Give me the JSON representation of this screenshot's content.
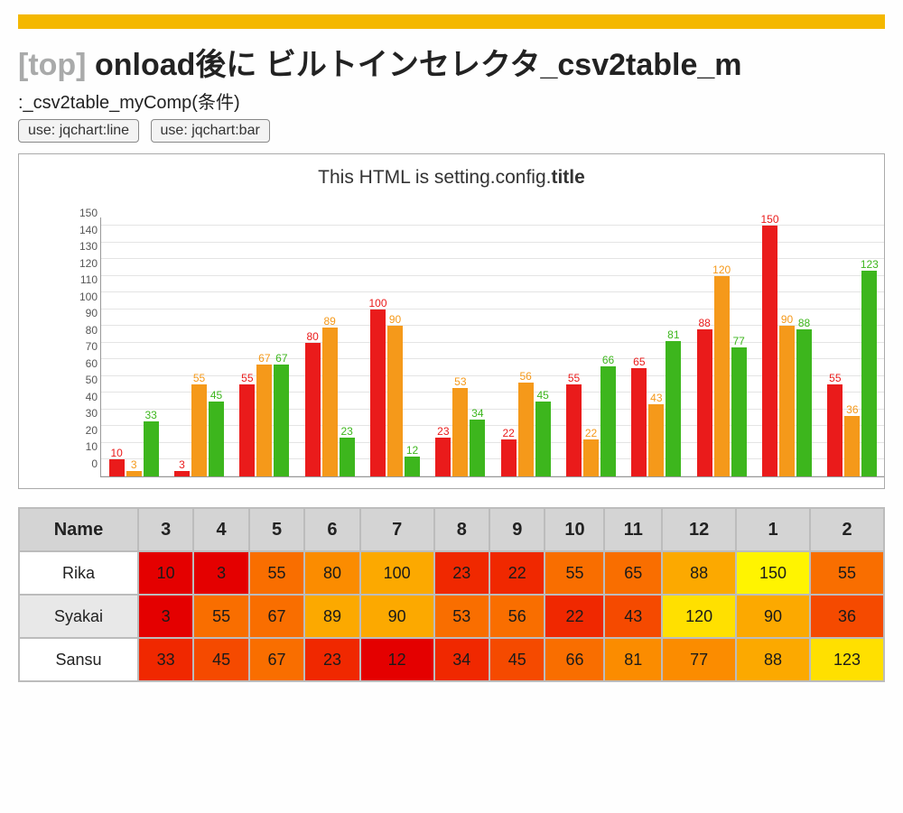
{
  "top_link_text": "[top]",
  "page_title_rest": " onload後に ビルトインセレクタ_csv2table_m",
  "subtitle": ":_csv2table_myComp(条件)",
  "buttons": {
    "line": "use: jqchart:line",
    "bar": "use: jqchart:bar"
  },
  "chart_title_prefix": "This HTML is setting.config.",
  "chart_title_bold": "title",
  "y_ticks": [
    0,
    10,
    20,
    30,
    40,
    50,
    60,
    70,
    80,
    90,
    100,
    110,
    120,
    130,
    140,
    150
  ],
  "y_max": 155,
  "table": {
    "headers": [
      "Name",
      "3",
      "4",
      "5",
      "6",
      "7",
      "8",
      "9",
      "10",
      "11",
      "12",
      "1",
      "2"
    ],
    "rows": [
      {
        "name": "Rika",
        "values": [
          10,
          3,
          55,
          80,
          100,
          23,
          22,
          55,
          65,
          88,
          150,
          55
        ]
      },
      {
        "name": "Syakai",
        "values": [
          3,
          55,
          67,
          89,
          90,
          53,
          56,
          22,
          43,
          120,
          90,
          36
        ]
      },
      {
        "name": "Sansu",
        "values": [
          33,
          45,
          67,
          23,
          12,
          34,
          45,
          66,
          81,
          77,
          88,
          123
        ]
      }
    ]
  },
  "chart_data": {
    "type": "bar",
    "title": "This HTML is setting.config.title",
    "xlabel": "",
    "ylabel": "",
    "ylim": [
      0,
      155
    ],
    "y_ticks": [
      0,
      10,
      20,
      30,
      40,
      50,
      60,
      70,
      80,
      90,
      100,
      110,
      120,
      130,
      140,
      150
    ],
    "categories": [
      "3",
      "4",
      "5",
      "6",
      "7",
      "8",
      "9",
      "10",
      "11",
      "12",
      "1",
      "2"
    ],
    "series": [
      {
        "name": "Rika",
        "color": "#ea1b1b",
        "values": [
          10,
          3,
          55,
          80,
          100,
          23,
          22,
          55,
          65,
          88,
          150,
          55
        ]
      },
      {
        "name": "Syakai",
        "color": "#f5991a",
        "values": [
          3,
          55,
          67,
          89,
          90,
          53,
          56,
          22,
          43,
          120,
          90,
          36
        ]
      },
      {
        "name": "Sansu",
        "color": "#3db61d",
        "values": [
          33,
          45,
          67,
          23,
          12,
          34,
          45,
          66,
          81,
          77,
          88,
          123
        ]
      }
    ]
  },
  "heat_colors": [
    "#e40000",
    "#f02800",
    "#f54a00",
    "#f96e00",
    "#fb8c00",
    "#fca900",
    "#fec400",
    "#ffe000",
    "#fff400"
  ]
}
